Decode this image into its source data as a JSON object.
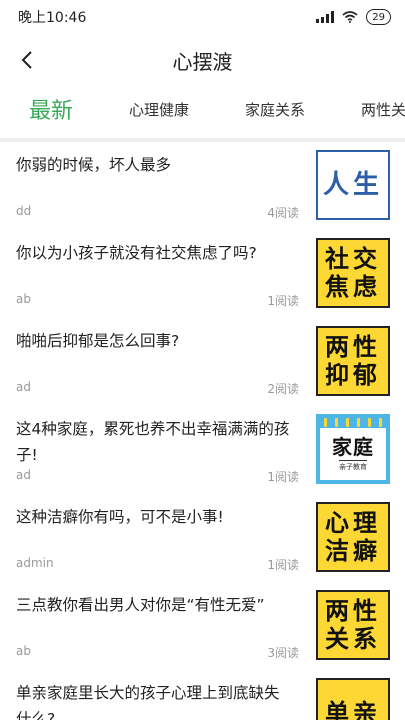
{
  "status": {
    "time": "晚上10:46",
    "battery": "29"
  },
  "header": {
    "title": "心摆渡"
  },
  "tabs": [
    {
      "label": "最新"
    },
    {
      "label": "心理健康"
    },
    {
      "label": "家庭关系"
    },
    {
      "label": "两性关系"
    }
  ],
  "articles": [
    {
      "title": "你弱的时候，坏人最多",
      "author": "dd",
      "reads": "4阅读",
      "thumb_text": "人生"
    },
    {
      "title": "你以为小孩子就没有社交焦虑了吗?",
      "author": "ab",
      "reads": "1阅读",
      "thumb_text": "社交焦虑"
    },
    {
      "title": "啪啪后抑郁是怎么回事?",
      "author": "ad",
      "reads": "2阅读",
      "thumb_text": "两性抑郁"
    },
    {
      "title": "这4种家庭，累死也养不出幸福满满的孩子!",
      "author": "ad",
      "reads": "1阅读",
      "thumb_text": "家庭",
      "thumb_sub": "亲子教育"
    },
    {
      "title": "这种洁癖你有吗，可不是小事!",
      "author": "admin",
      "reads": "1阅读",
      "thumb_text": "心理洁癖"
    },
    {
      "title": "三点教你看出男人对你是“有性无爱”",
      "author": "ab",
      "reads": "3阅读",
      "thumb_text": "两性关系"
    },
    {
      "title": "单亲家庭里长大的孩子心理上到底缺失什么?",
      "author": "",
      "reads": "",
      "thumb_text": "单亲"
    }
  ]
}
